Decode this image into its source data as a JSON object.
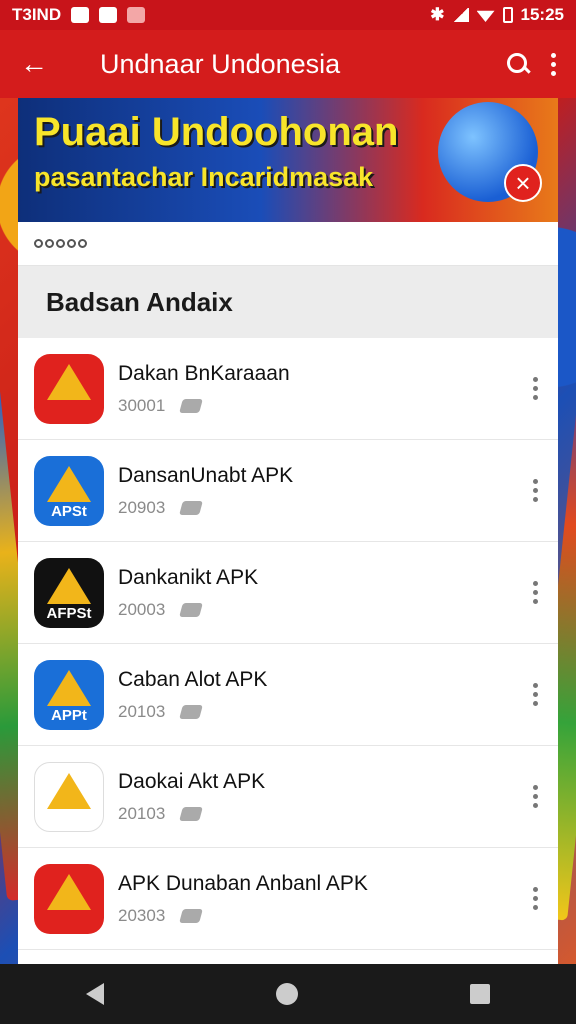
{
  "status_bar": {
    "left_text": "T3IND",
    "time": "15:25"
  },
  "app_bar": {
    "title": "Undnaar Undonesia"
  },
  "banner": {
    "title": "Puaai Undoohonan",
    "subtitle": "pasantachar Incaridmasak"
  },
  "chips_text": "",
  "section": {
    "title": "Badsan Andaix"
  },
  "list": [
    {
      "title": "Dakan BnKaraaan",
      "sub": "30001",
      "icon_color": "#e0221e",
      "icon_label": ""
    },
    {
      "title": "DansanUnabt APK",
      "sub": "20903",
      "icon_color": "#1a6fd8",
      "icon_label": "APSt"
    },
    {
      "title": "Dankanikt APK",
      "sub": "20003",
      "icon_color": "#111111",
      "icon_label": "AFPSt"
    },
    {
      "title": "Caban Alot APK",
      "sub": "20103",
      "icon_color": "#1a6fd8",
      "icon_label": "APPt"
    },
    {
      "title": "Daokai Akt APK",
      "sub": "20103",
      "icon_color": "#ffffff",
      "icon_label": ""
    },
    {
      "title": "APK Dunaban Anbanl APK",
      "sub": "20303",
      "icon_color": "#e0221e",
      "icon_label": ""
    }
  ],
  "colors": {
    "app_bar": "#d41c1c",
    "status_bar": "#c8141a",
    "accent_yellow": "#f8e52a"
  }
}
